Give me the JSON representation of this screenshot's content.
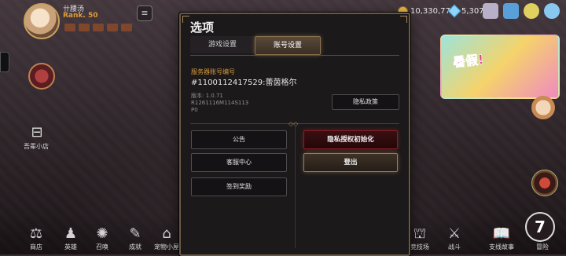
{
  "hud": {
    "player_name": "卄腰汤",
    "rank": "Rank. 50",
    "gold": "10,330,778",
    "gems": "5,307"
  },
  "side": {
    "left_label": "吾辈小店"
  },
  "bottom_bar": {
    "items": [
      {
        "label": "商店",
        "icon": "shop-icon",
        "glyph": "⚖"
      },
      {
        "label": "英雄",
        "icon": "hero-icon",
        "glyph": "♟"
      },
      {
        "label": "召唤",
        "icon": "summon-icon",
        "glyph": "✺"
      },
      {
        "label": "成就",
        "icon": "achievement-icon",
        "glyph": "✎"
      },
      {
        "label": "宠物小屋",
        "icon": "pet-house-icon",
        "glyph": "⌂"
      },
      {
        "label": "竞技场",
        "icon": "arena-icon",
        "glyph": "⛫"
      },
      {
        "label": "战斗",
        "icon": "battle-icon",
        "glyph": "⚔"
      },
      {
        "label": "支线故事",
        "icon": "side-story-icon",
        "glyph": "📖"
      },
      {
        "label": "冒险",
        "icon": "adventure-icon",
        "glyph": "7"
      }
    ]
  },
  "dialog": {
    "title": "选项",
    "tabs": [
      "游戏设置",
      "账号设置"
    ],
    "active_tab": "账号设置",
    "server_label": "服务器账号编号",
    "server_value": "#1100112417529:蕾茵格尔",
    "version_lines": [
      "版本: 1.0.71",
      "R1261116M114S113",
      "P0"
    ],
    "privacy_policy": "隐私政策",
    "left_buttons": [
      "公告",
      "客服中心",
      "签到奖励"
    ],
    "reset_privacy": "隐私授权初始化",
    "logout": "登出"
  },
  "colors": {
    "accent_gold": "#d49a3c",
    "danger_red": "#8a1e24"
  }
}
